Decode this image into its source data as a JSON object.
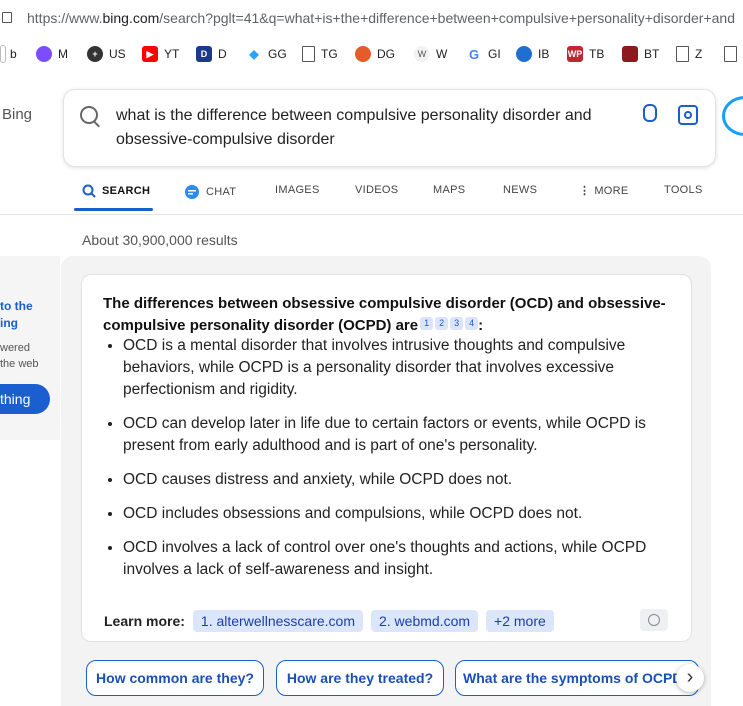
{
  "browser": {
    "url_prefix": "https://www.",
    "url_host": "bing.com",
    "url_rest": "/search?pglt=41&q=what+is+the+difference+between+compulsive+personality+disorder+and"
  },
  "bookmarks": [
    {
      "label": "b",
      "icon": "bookmark-b-icon",
      "color": "#777777"
    },
    {
      "label": "M",
      "icon": "messenger-icon",
      "color": "#7b4dff"
    },
    {
      "label": "US",
      "icon": "us-icon",
      "color": "#333333"
    },
    {
      "label": "YT",
      "icon": "youtube-icon",
      "color": "#ff0000"
    },
    {
      "label": "D",
      "icon": "d-icon",
      "color": "#1b3a8a"
    },
    {
      "label": "GG",
      "icon": "gg-icon",
      "color": "#26a4ff"
    },
    {
      "label": "TG",
      "icon": "page-icon",
      "color": "#ffffff"
    },
    {
      "label": "DG",
      "icon": "dg-icon",
      "color": "#e55c2b"
    },
    {
      "label": "W",
      "icon": "wikipedia-icon",
      "color": "#888888"
    },
    {
      "label": "GI",
      "icon": "google-icon",
      "color": "#4285f4"
    },
    {
      "label": "IB",
      "icon": "ib-icon",
      "color": "#1f6fd1"
    },
    {
      "label": "TB",
      "icon": "tb-icon",
      "color": "#c0262d"
    },
    {
      "label": "BT",
      "icon": "bt-icon",
      "color": "#8b1a1a"
    },
    {
      "label": "Z",
      "icon": "page-icon",
      "color": "#ffffff"
    }
  ],
  "header": {
    "brand": "Bing",
    "query": "what is the difference between compulsive personality disorder and obsessive-compulsive disorder"
  },
  "tabs": [
    {
      "label": "SEARCH",
      "active": true
    },
    {
      "label": "CHAT",
      "active": false
    },
    {
      "label": "IMAGES",
      "active": false
    },
    {
      "label": "VIDEOS",
      "active": false
    },
    {
      "label": "MAPS",
      "active": false
    },
    {
      "label": "NEWS",
      "active": false
    },
    {
      "label": "MORE",
      "active": false
    },
    {
      "label": "TOOLS",
      "active": false
    }
  ],
  "results_count": "About 30,900,000 results",
  "left_panel": {
    "title_line1": "to the",
    "title_line2": "ing",
    "desc_line1": "wered",
    "desc_line2": "the web",
    "button": "thing"
  },
  "answer": {
    "heading": "The differences between obsessive compulsive disorder (OCD) and obsessive-compulsive personality disorder (OCPD) are",
    "citations": [
      "1",
      "2",
      "3",
      "4"
    ],
    "colon": ":",
    "bullets": [
      "OCD is a mental disorder that involves intrusive thoughts and compulsive behaviors, while OCPD is a personality disorder that involves excessive perfectionism and rigidity.",
      "OCD can develop later in life due to certain factors or events, while OCPD is present from early adulthood and is part of one's personality.",
      "OCD causes distress and anxiety, while OCPD does not.",
      "OCD includes obsessions and compulsions, while OCPD does not.",
      "OCD involves a lack of control over one's thoughts and actions, while OCPD involves a lack of self-awareness and insight."
    ],
    "learn_more_label": "Learn more:",
    "sources": [
      "1. alterwellnesscare.com",
      "2. webmd.com",
      "+2 more"
    ]
  },
  "suggestions": [
    "How common are they?",
    "How are they treated?",
    "What are the symptoms of OCPD?"
  ],
  "colors": {
    "accent": "#1a5ecf",
    "chip_bg": "#dce6fb"
  }
}
